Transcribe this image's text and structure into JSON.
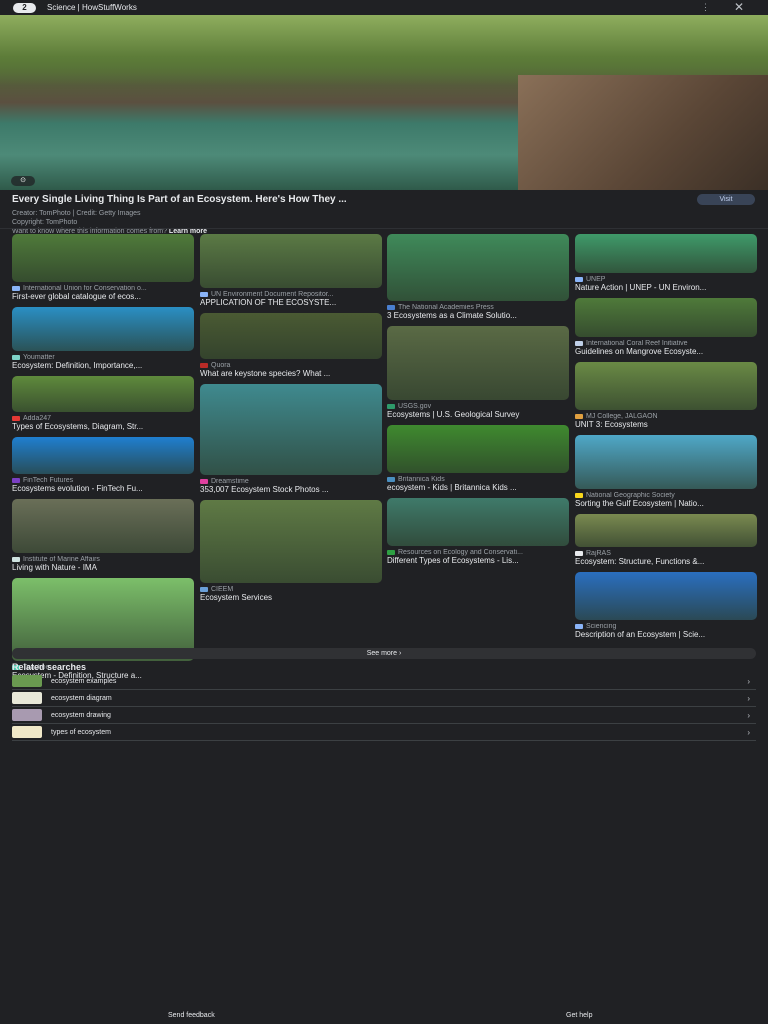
{
  "topbar": {
    "logo": "2",
    "site": "Science | HowStuffWorks",
    "more_icon": "⋮",
    "close_icon": "✕"
  },
  "preview": {
    "lens_icon": "⊙",
    "title": "Every Single Living Thing Is Part of an Ecosystem. Here's How They ...",
    "creator": "Creator: TomPhoto | Credit: Getty Images",
    "copyright": "Copyright: TomPhoto",
    "info_question": "Want to know where this information comes from?",
    "learn_more": "Learn more",
    "visit": "Visit"
  },
  "columns": [
    [
      {
        "source": "International Union for Conservation o...",
        "title": "First-ever global catalogue of ecos...",
        "img": "#4f7a3a",
        "fav": "#8ab4f8"
      },
      {
        "source": "Youmatter",
        "title": "Ecosystem: Definition, Importance,...",
        "img": "#2a8fc4",
        "fav": "#7fd3c8"
      },
      {
        "source": "Adda247",
        "title": "Types of Ecosystems, Diagram, Str...",
        "img": "#5f8a3c",
        "fav": "#e53935"
      },
      {
        "source": "FinTech Futures",
        "title": "Ecosystems evolution - FinTech Fu...",
        "img": "#1f7fd0",
        "fav": "#7b3fc4"
      },
      {
        "source": "Institute of Marine Affairs",
        "title": "Living with Nature - IMA",
        "img": "#6a6f58",
        "fav": "#cfe3e0"
      },
      {
        "source": "Teachoo",
        "title": "Ecosystem - Definition, Structure a...",
        "img": "#7cbf6a",
        "fav": "#4ec9b0"
      }
    ],
    [
      {
        "source": "UN Environment Document Repositor...",
        "title": "APPLICATION OF THE ECOSYSTE...",
        "img": "#5b7a45",
        "fav": "#8ab4f8"
      },
      {
        "source": "Quora",
        "title": "What are keystone species? What ...",
        "img": "#4a5a33",
        "fav": "#b92b27"
      },
      {
        "source": "Dreamstime",
        "title": "353,007 Ecosystem Stock Photos ...",
        "img": "#3f8a8f",
        "fav": "#e040a0"
      },
      {
        "source": "CIEEM",
        "title": "Ecosystem Services",
        "img": "#5f7a45",
        "fav": "#6a9fd8"
      }
    ],
    [
      {
        "source": "The National Academies Press",
        "title": "3 Ecosystems as a Climate Solutio...",
        "img": "#3f8a5a",
        "fav": "#4a7fd0"
      },
      {
        "source": "USGS.gov",
        "title": "Ecosystems | U.S. Geological Survey",
        "img": "#5a6a45",
        "fav": "#2e9a6a"
      },
      {
        "source": "Britannica Kids",
        "title": "ecosystem - Kids | Britannica Kids ...",
        "img": "#3f8a2f",
        "fav": "#4a8fc0"
      },
      {
        "source": "Resources on Ecology and Conservati...",
        "title": "Different Types of Ecosystems - Lis...",
        "img": "#3f7a6a",
        "fav": "#2ea043"
      }
    ],
    [
      {
        "source": "UNEP",
        "title": "Nature Action | UNEP - UN Environ...",
        "img": "#3f9a6a",
        "fav": "#8ab4f8"
      },
      {
        "source": "International Coral Reef Initiative",
        "title": "Guidelines on Mangrove Ecosyste...",
        "img": "#4f7a3a",
        "fav": "#c0d0e8"
      },
      {
        "source": "MJ College, JALGAON",
        "title": "UNIT 3: Ecosystems",
        "img": "#6a8a45",
        "fav": "#e0a040"
      },
      {
        "source": "National Geographic Society",
        "title": "Sorting the Gulf Ecosystem | Natio...",
        "img": "#4fa8c8",
        "fav": "#f9d71c"
      },
      {
        "source": "RajRAS",
        "title": "Ecosystem: Structure, Functions &...",
        "img": "#7a8a50",
        "fav": "#e8eaed"
      },
      {
        "source": "Sciencing",
        "title": "Description of an Ecosystem | Scie...",
        "img": "#2a6fc0",
        "fav": "#8ab4f8"
      }
    ]
  ],
  "see_more": "See more  ›",
  "related": {
    "heading": "Related searches",
    "items": [
      {
        "label": "ecosystem examples",
        "img": "#6a9a50"
      },
      {
        "label": "ecosystem diagram",
        "img": "#e8e8d8"
      },
      {
        "label": "ecosystem drawing",
        "img": "#a89ab0"
      },
      {
        "label": "types of ecosystem",
        "img": "#f0e8c8"
      }
    ],
    "chevron": "›"
  },
  "footer": {
    "feedback": "Send feedback",
    "help": "Get help"
  }
}
